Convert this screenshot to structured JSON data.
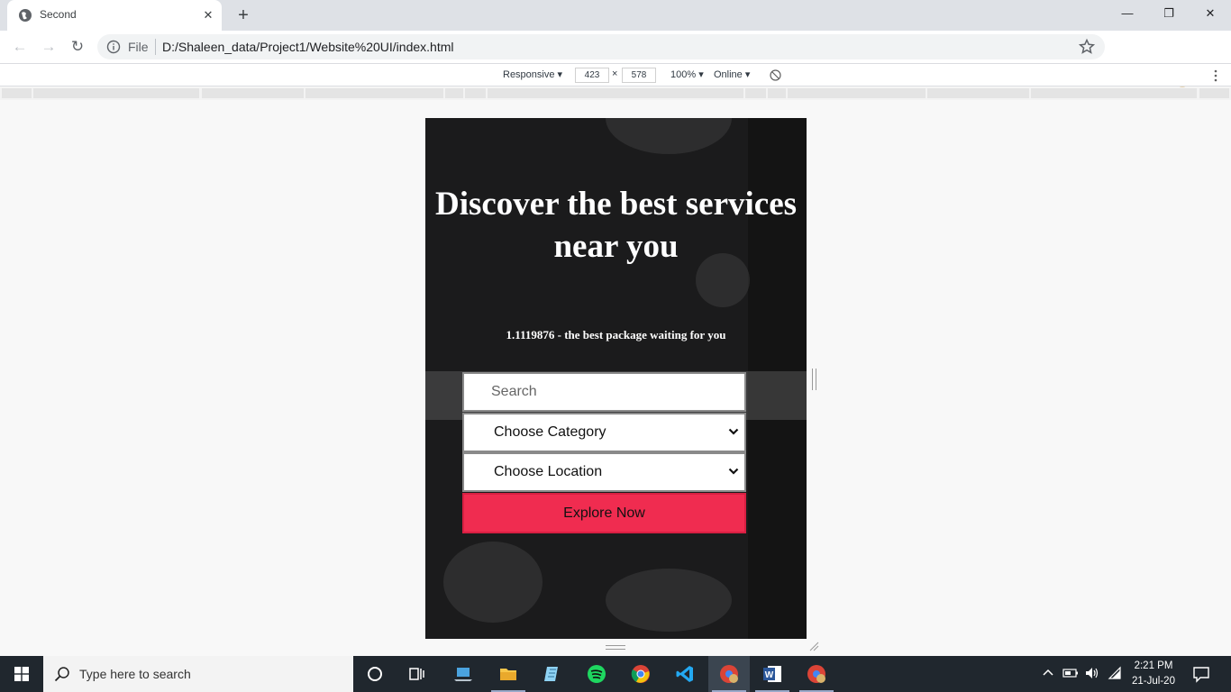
{
  "browser": {
    "tab_title": "Second",
    "new_tab_label": "+",
    "window_controls": {
      "minimize": "—",
      "maximize": "❐",
      "close": "✕"
    },
    "nav": {
      "back": "←",
      "forward": "→",
      "reload": "↻"
    },
    "address": {
      "scheme_label": "File",
      "url": "D:/Shaleen_data/Project1/Website%20UI/index.html"
    }
  },
  "devtools": {
    "device_mode": "Responsive ▾",
    "width": "423",
    "times": "×",
    "height": "578",
    "zoom": "100% ▾",
    "network": "Online ▾"
  },
  "page": {
    "hero_title": "Discover the best services near you",
    "hero_subtitle": "1.1119876 - the best package waiting for you",
    "search_placeholder": "Search",
    "category_select": "Choose Category",
    "location_select": "Choose Location",
    "explore_button": "Explore Now",
    "accent_color": "#f02c50"
  },
  "taskbar": {
    "search_placeholder": "Type here to search",
    "time": "2:21 PM",
    "date": "21-Jul-20",
    "apps": [
      "cortana-icon",
      "task-view-icon",
      "laptop-icon",
      "file-explorer-icon",
      "notepad-icon",
      "spotify-icon",
      "chrome-icon",
      "vscode-icon",
      "chrome-profile-icon",
      "word-icon",
      "chrome-profile-icon"
    ]
  }
}
